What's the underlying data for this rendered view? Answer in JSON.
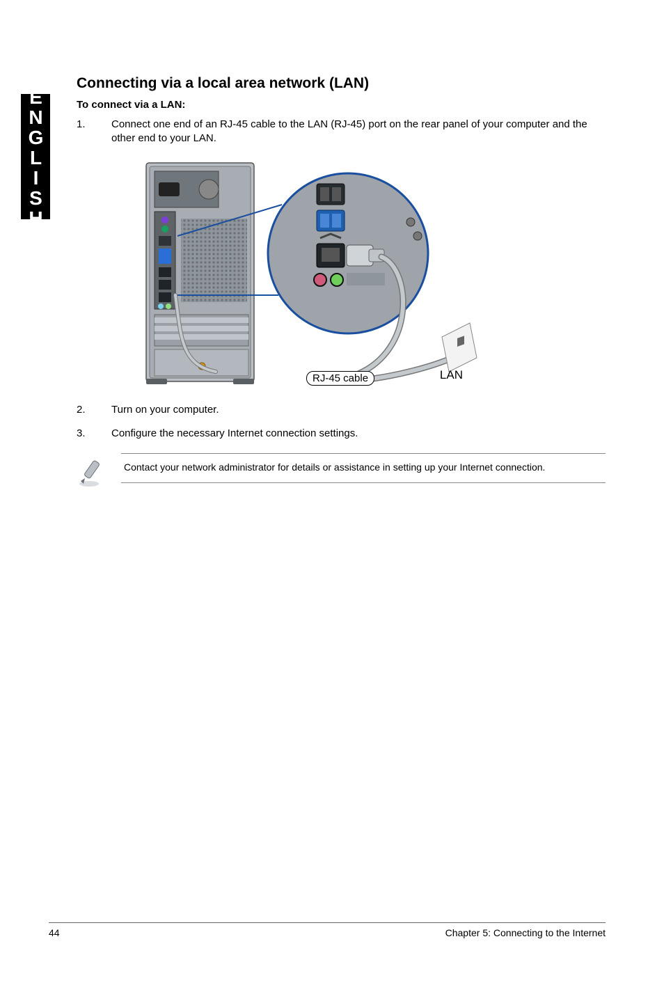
{
  "sidebar": {
    "language": "ENGLISH"
  },
  "section": {
    "title": "Connecting via a local area network (LAN)",
    "subtitle": "To connect via a LAN:"
  },
  "steps": [
    {
      "num": "1.",
      "text": "Connect one end of an RJ-45 cable to the LAN (RJ-45) port on the rear panel of your computer and the other end to your LAN."
    },
    {
      "num": "2.",
      "text": "Turn on your computer."
    },
    {
      "num": "3.",
      "text": "Configure the necessary Internet connection settings."
    }
  ],
  "figure": {
    "cable_label": "RJ-45 cable",
    "lan_label": "LAN"
  },
  "note": {
    "text": "Contact your network administrator for details or assistance in setting up your Internet connection."
  },
  "footer": {
    "page": "44",
    "chapter": "Chapter 5: Connecting to the Internet"
  }
}
